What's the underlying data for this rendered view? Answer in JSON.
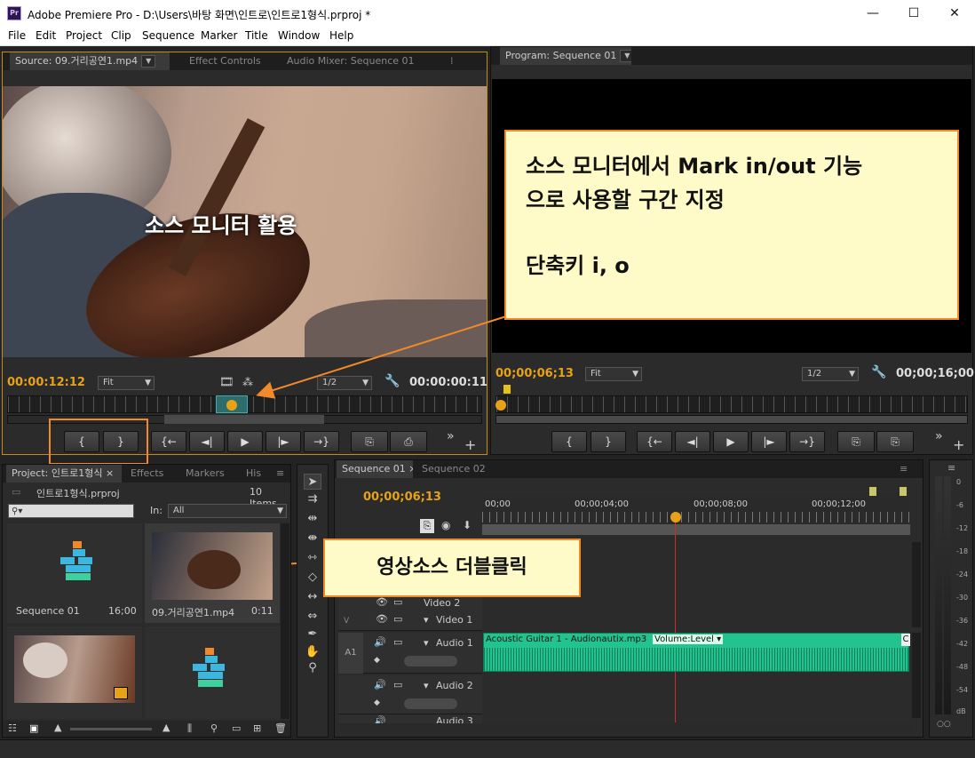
{
  "window": {
    "icon": "Pr",
    "title": "Adobe Premiere Pro - D:\\Users\\바탕 화면\\인트로\\인트로1형식.prproj *",
    "minimize": "—",
    "maximize": "☐",
    "close": "✕"
  },
  "menu": [
    "File",
    "Edit",
    "Project",
    "Clip",
    "Sequence",
    "Marker",
    "Title",
    "Window",
    "Help"
  ],
  "source_panel": {
    "tabs": [
      "Source: 09.거리공연1.mp4",
      "Effect Controls",
      "Audio Mixer: Sequence 01"
    ],
    "tab_more": "⁞",
    "overlay_text": "소스 모니터 활용",
    "timecode_current": "00:00:12:12",
    "fit": "Fit",
    "resolution": "1/2",
    "timecode_duration": "00:00:00:11",
    "buttons": [
      "{",
      "}",
      "{←",
      "◄|",
      "▶",
      "|►",
      "→}",
      "⎘",
      "⎙"
    ],
    "more": "»",
    "plus": "+"
  },
  "program_panel": {
    "tab": "Program: Sequence 01",
    "timecode_current": "00;00;06;13",
    "fit": "Fit",
    "resolution": "1/2",
    "timecode_duration": "00;00;16;00",
    "buttons": [
      "{",
      "}",
      "{←",
      "◄|",
      "▶",
      "|►",
      "→}",
      "⎘",
      "⎘"
    ],
    "more": "»",
    "plus": "+"
  },
  "callout_main": {
    "line1": "소스 모니터에서  Mark in/out 기능",
    "line2": "으로 사용할 구간 지정",
    "line3": "단축키 i, o"
  },
  "callout_double_click": "영상소스 더블클릭",
  "project_panel": {
    "tabs": [
      "Project: 인트로1형식",
      "Effects",
      "Markers",
      "His"
    ],
    "file_name": "인트로1형식.prproj",
    "item_count": "10 Items",
    "in_label": "In:",
    "in_value": "All",
    "items": [
      {
        "name": "Sequence 01",
        "duration": "16;00"
      },
      {
        "name": "09.거리공연1.mp4",
        "duration": "0:11"
      },
      {
        "name": "",
        "duration": ""
      },
      {
        "name": "",
        "duration": ""
      }
    ]
  },
  "timeline": {
    "tabs": [
      "Sequence 01",
      "Sequence 02"
    ],
    "timecode": "00;00;06;13",
    "ruler_labels": [
      "00;00",
      "00;00;04;00",
      "00;00;08;00",
      "00;00;12;00"
    ],
    "tracks": [
      {
        "name": "Video 2",
        "kind": "video"
      },
      {
        "name": "Video 1",
        "kind": "video"
      },
      {
        "name": "Audio 1",
        "kind": "audio",
        "side": "A1"
      },
      {
        "name": "Audio 2",
        "kind": "audio"
      },
      {
        "name": "Audio 3",
        "kind": "audio"
      }
    ],
    "side_v": "V",
    "clip_name": "Acoustic Guitar 1 - Audionautix.mp3",
    "clip_fx": "Volume:Level",
    "clip_end": "C"
  },
  "meter": {
    "labels": [
      "0",
      "-6",
      "-12",
      "-18",
      "-24",
      "-30",
      "-36",
      "-42",
      "-48",
      "-54",
      "dB"
    ],
    "bottom": "○○"
  },
  "colors": {
    "timecode": "#e7a217",
    "callout_bg": "#fffbc8",
    "callout_border": "#f08a2a",
    "audio_clip": "#22c38e",
    "playhead": "#d02a2a"
  }
}
